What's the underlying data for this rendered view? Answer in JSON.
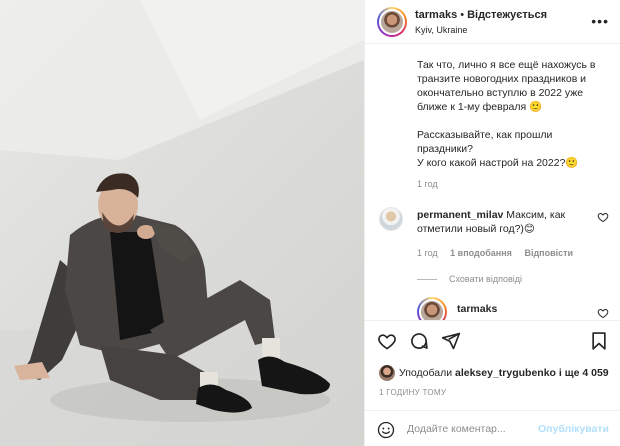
{
  "post": {
    "username": "tarmaks",
    "separator": "•",
    "follow_status": "Відстежується",
    "location": "Kyiv, Ukraine",
    "more_icon": "more-icon"
  },
  "caption": {
    "text": "Так что, лично я все ещё нахожусь в транзите новогодних праздников и окончательно вступлю в 2022 уже ближе к 1-му февраля 🙂\n\nРассказывайте, как прошли праздники?\nУ кого какой настрой на 2022?🙂",
    "time": "1 год"
  },
  "comment": {
    "username": "permanent_milav",
    "text": "Максим, как отметили новый год?)😊",
    "time": "1 год",
    "likes": "1 вподобання",
    "reply": "Відповісти",
    "hide_replies": "Сховати відповіді"
  },
  "reply": {
    "username": "tarmaks"
  },
  "actions": {
    "liked_by_prefix": "Уподобали",
    "liked_by_user": "aleksey_trygubenko",
    "liked_by_suffix": "і ще 4 059",
    "post_time": "1 ГОДИНУ ТОМУ"
  },
  "add_comment": {
    "placeholder": "Додайте коментар...",
    "publish": "Опублікувати"
  },
  "colors": {
    "text": "#262626",
    "muted": "#8e8e8e",
    "divider": "#efefef",
    "publish_disabled": "#b2dffc"
  }
}
